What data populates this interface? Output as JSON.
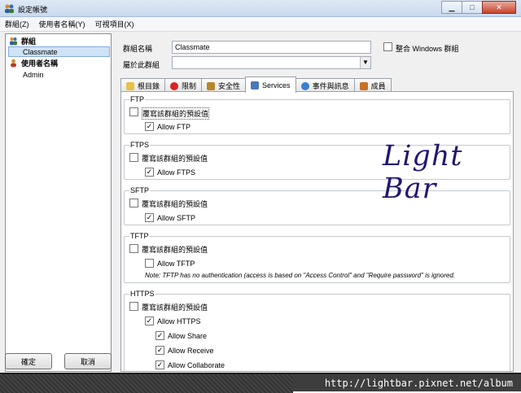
{
  "window": {
    "title": "設定帳號"
  },
  "menu": [
    "群組(Z)",
    "使用者名稱(Y)",
    "可視項目(X)"
  ],
  "tree": {
    "groups_label": "群組",
    "group_items": [
      "Classmate"
    ],
    "users_label": "使用者名稱",
    "user_items": [
      "Admin"
    ]
  },
  "buttons": {
    "ok": "確定",
    "cancel": "取消"
  },
  "form": {
    "group_name_label": "群組名稱",
    "group_name_value": "Classmate",
    "windows_group_label": "整合 Windows 群組",
    "belongs_label": "屬於此群組",
    "belongs_value": ""
  },
  "tabs": [
    "根目錄",
    "限制",
    "安全性",
    "Services",
    "事件與訊息",
    "成員"
  ],
  "services": {
    "override_label": "覆寫該群組的預設值",
    "ftp": {
      "title": "FTP",
      "allow": "Allow FTP"
    },
    "ftps": {
      "title": "FTPS",
      "allow": "Allow FTPS"
    },
    "sftp": {
      "title": "SFTP",
      "allow": "Allow SFTP"
    },
    "tftp": {
      "title": "TFTP",
      "allow": "Allow TFTP",
      "note": "Note: TFTP has no authentication (access is based on \"Access Control\" and \"Require password\" is ignored."
    },
    "https": {
      "title": "HTTPS",
      "allow": "Allow HTTPS",
      "share": "Allow Share",
      "receive": "Allow Receive",
      "collaborate": "Allow Collaborate"
    }
  },
  "watermark": "Light Bar",
  "footer_url": "http://lightbar.pixnet.net/album",
  "colors": {
    "titlebar": "#c9d9ee",
    "selection": "#cfe3f7",
    "watermark": "#221670",
    "close": "#c7432a"
  }
}
